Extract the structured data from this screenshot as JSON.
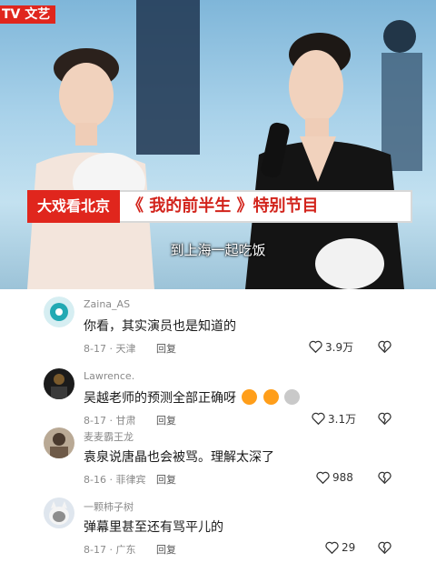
{
  "video": {
    "channel_logo": "TV 文艺",
    "banner_left": "大戏看北京",
    "banner_title": "《 我的前半生 》特别节目",
    "subtitle": "到上海一起吃饭",
    "brand_red": "#e0261d"
  },
  "comments": [
    {
      "user": "Zaina_AS",
      "text": "你看，其实演员也是知道的",
      "date": "8-17",
      "location": "天津",
      "reply": "回复",
      "likes": "3.9万",
      "avatar_icon": "teal-avatar"
    },
    {
      "user": "Lawrence.",
      "text": "吴越老师的预测全部正确呀",
      "emojis": [
        "angry-face-emoji",
        "angry-face-emoji",
        "cat-face-emoji"
      ],
      "date": "8-17",
      "location": "甘肃",
      "reply": "回复",
      "likes": "3.1万",
      "avatar_icon": "dark-photo-avatar"
    },
    {
      "user": "麦麦霸王龙",
      "text": "袁泉说唐晶也会被骂。理解太深了",
      "date": "8-16",
      "location": "菲律宾",
      "reply": "回复",
      "likes": "988",
      "avatar_icon": "person-photo-avatar"
    },
    {
      "user": "一颗柿子树",
      "text": "弹幕里甚至还有骂平儿的",
      "date": "8-17",
      "location": "广东",
      "reply": "回复",
      "likes": "29",
      "avatar_icon": "cat-photo-avatar"
    }
  ]
}
